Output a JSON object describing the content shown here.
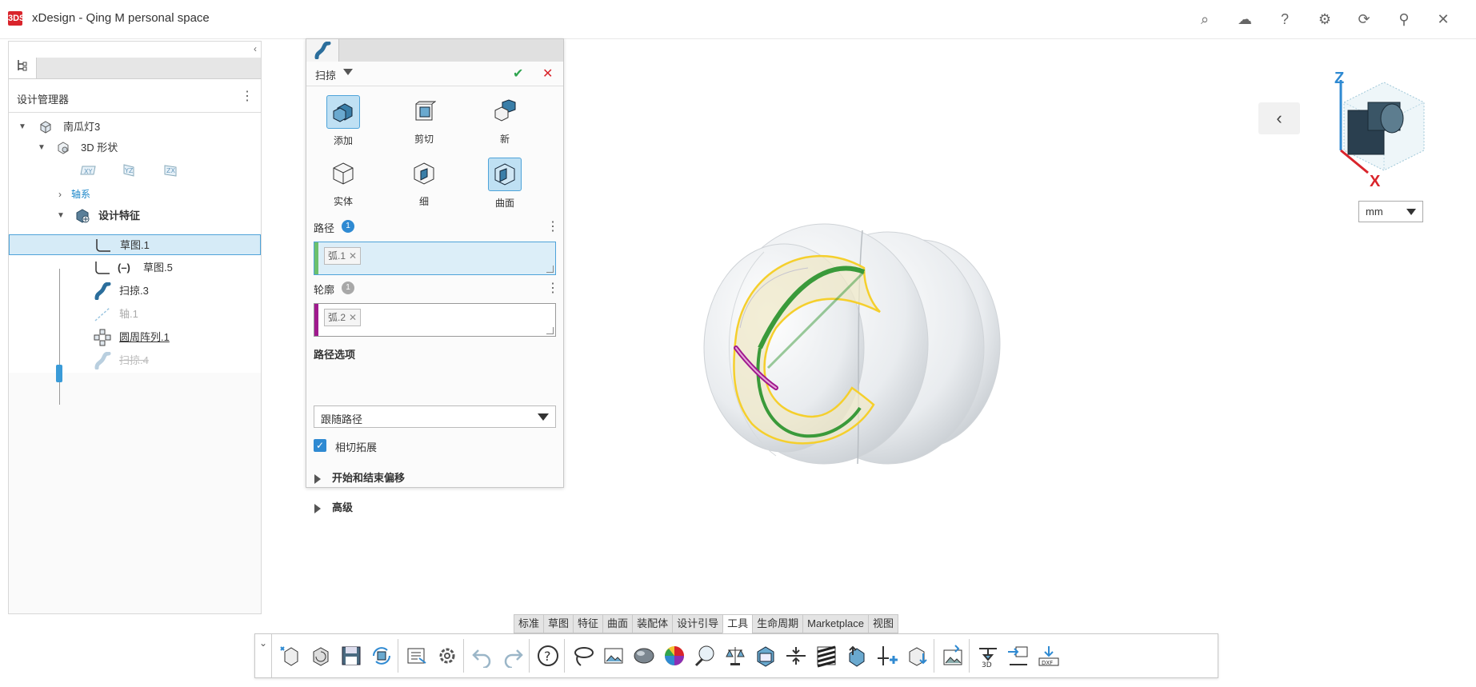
{
  "app": {
    "logo": "3DS",
    "title": "xDesign - Qing M personal space"
  },
  "top_icons": [
    "search-icon",
    "cloud-icon",
    "help-icon",
    "gear-icon",
    "refresh-icon",
    "pin-icon",
    "close-icon"
  ],
  "top_glyphs": {
    "search": "⌕",
    "cloud": "☁",
    "help": "?",
    "gear": "⚙",
    "refresh": "⟳",
    "pin": "⚲",
    "close": "✕"
  },
  "left_panel": {
    "title": "设计管理器",
    "tree": {
      "root": "南瓜灯3",
      "shapes": "3D 形状",
      "planes": [
        "XY",
        "YZ",
        "ZX"
      ],
      "axes": "轴系",
      "features": "设计特征",
      "items": [
        {
          "label": "草图.1"
        },
        {
          "prefix": "(–)",
          "label": "草图.5"
        },
        {
          "label": "扫掠.3"
        },
        {
          "label": "轴.1"
        },
        {
          "label": "圆周阵列.1"
        },
        {
          "label": "扫掠.4"
        }
      ]
    }
  },
  "sweep": {
    "title": "扫掠",
    "ok": "✔",
    "cancel": "✕",
    "ops": [
      "添加",
      "剪切",
      "新",
      "实体",
      "细",
      "曲面"
    ],
    "path_label": "路径",
    "path_count": "1",
    "path_chip": "弧.1",
    "profile_label": "轮廓",
    "profile_count": "1",
    "profile_chip": "弧.2",
    "path_options_label": "路径选项",
    "path_option_value": "跟随路径",
    "tangent_label": "相切拓展",
    "start_end_label": "开始和结束偏移",
    "advanced_label": "高级"
  },
  "viewport": {
    "axis_z": "Z",
    "axis_x": "X",
    "units": "mm"
  },
  "cmd_tabs": [
    "标准",
    "草图",
    "特征",
    "曲面",
    "装配体",
    "设计引导",
    "工具",
    "生命周期",
    "Marketplace",
    "视图"
  ],
  "active_tab": "工具",
  "colors": {
    "accent": "#2f8ad2",
    "path_bar": "#6cc06c",
    "profile_bar": "#a0198e",
    "ok": "#2fa44f",
    "cancel": "#d9242b",
    "curve_yellow": "#f5cf2c",
    "curve_green": "#3a9a3a"
  }
}
